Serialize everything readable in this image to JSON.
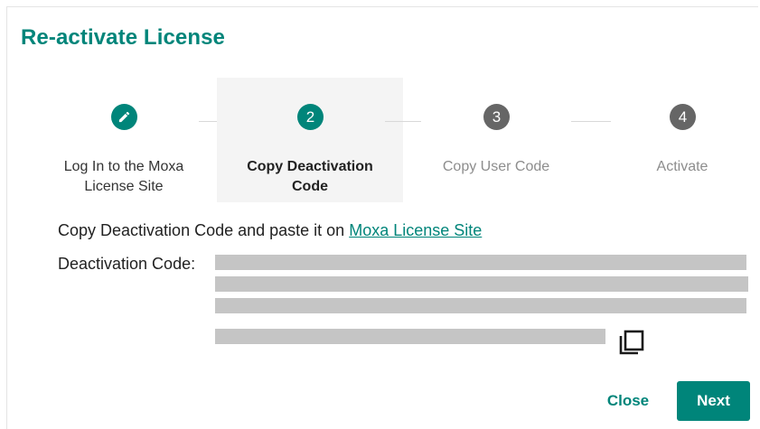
{
  "dialog": {
    "title": "Re-activate License"
  },
  "steps": [
    {
      "number": "",
      "icon": "pencil-icon",
      "label_line1": "Log In to the Moxa",
      "label_line2": "License Site",
      "state": "done"
    },
    {
      "number": "2",
      "label_line1": "Copy Deactivation",
      "label_line2": "Code",
      "state": "current"
    },
    {
      "number": "3",
      "label_line1": "Copy User Code",
      "label_line2": "",
      "state": "pending"
    },
    {
      "number": "4",
      "label_line1": "Activate",
      "label_line2": "",
      "state": "pending"
    }
  ],
  "instruction": {
    "text": "Copy Deactivation Code and paste it on ",
    "link_text": "Moxa License Site"
  },
  "code": {
    "label": "Deactivation Code:",
    "redacted": true
  },
  "actions": {
    "copy_icon": "copy-icon",
    "close_label": "Close",
    "next_label": "Next"
  },
  "colors": {
    "accent": "#00857a",
    "pending_step": "#666666",
    "redaction": "#c5c5c5"
  }
}
